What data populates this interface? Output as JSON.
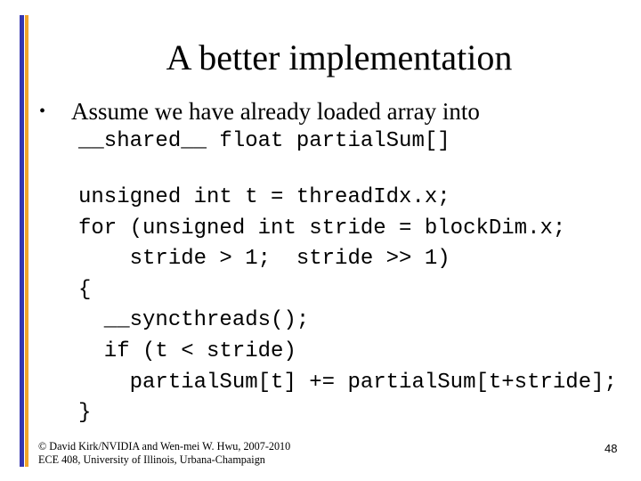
{
  "slide": {
    "title": "A better implementation",
    "bullet": {
      "icon": "bullet-dot-icon",
      "glyph": "•",
      "text": "Assume we have already loaded array into"
    },
    "shared_decl": "__shared__ float partialSum[]",
    "code_lines": [
      "unsigned int t = threadIdx.x;",
      "for (unsigned int stride = blockDim.x;",
      "    stride > 1;  stride >> 1)",
      "{",
      "  __syncthreads();",
      "  if (t < stride)",
      "    partialSum[t] += partialSum[t+stride];",
      "}"
    ],
    "footer": {
      "line1": "© David Kirk/NVIDIA and Wen-mei W. Hwu, 2007-2010",
      "line2": "ECE 408, University of Illinois, Urbana-Champaign"
    },
    "page_number": "48"
  },
  "colors": {
    "accent_bar_blue": "#3636b0",
    "accent_bar_orange": "#f0a428",
    "text": "#000000",
    "background": "#ffffff"
  }
}
